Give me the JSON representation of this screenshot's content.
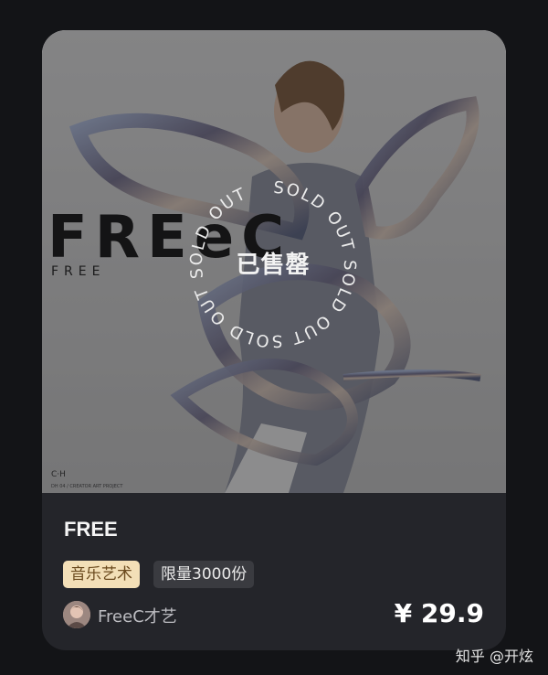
{
  "card": {
    "artwork": {
      "big_logo": "FREeC",
      "small_logo": "FREE",
      "corner_mark": "C·H",
      "credit": "DH 04 / CREATOR ART PROJECT",
      "sold_ring_text": "SOLD OUT SOLD OUT SOLD OUT SOLD OUT ",
      "sold_center": "已售罄"
    },
    "title": "FREE",
    "tags": [
      "音乐艺术",
      "限量3000份"
    ],
    "creator": "FreeC才艺",
    "price": "¥ 29.9"
  },
  "watermark": "知乎 @开炫",
  "colors": {
    "background": "#131417",
    "card": "#24252a",
    "tag_primary_bg": "#f3dfb7",
    "tag_primary_text": "#6b4a1e",
    "tag_secondary_bg": "#3a3b40"
  }
}
